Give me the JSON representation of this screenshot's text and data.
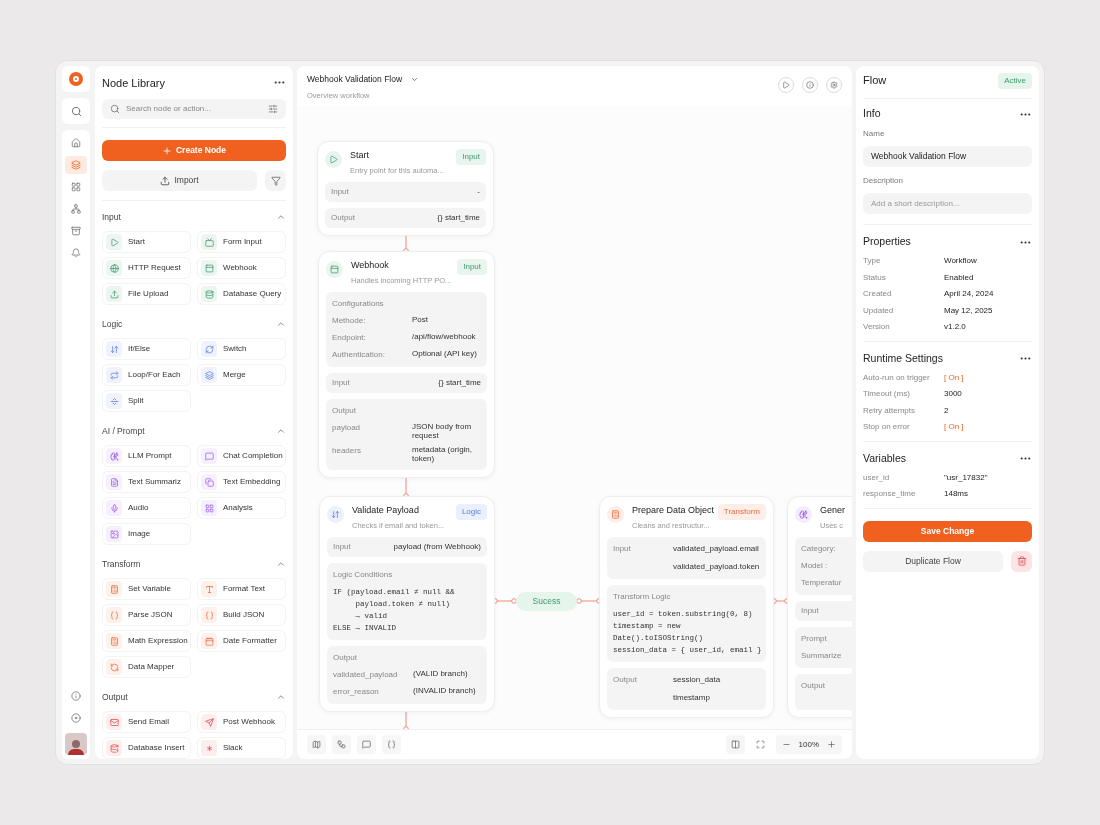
{
  "nav": [
    {
      "selected": false
    },
    {
      "selected": true
    },
    {
      "selected": false
    },
    {
      "selected": false
    },
    {
      "selected": false
    },
    {
      "selected": false
    }
  ],
  "library": {
    "title": "Node Library",
    "search_placeholder": "Search node or action...",
    "create_label": "Create Node",
    "import_label": "Import",
    "sections": [
      {
        "title": "Input",
        "expanded": true,
        "kind": "input",
        "items": [
          "Start",
          "Form Input",
          "HTTP Request",
          "Webhook",
          "File Upload",
          "Database Query"
        ]
      },
      {
        "title": "Logic",
        "expanded": true,
        "kind": "logic",
        "items": [
          "If/Else",
          "Switch",
          "Loop/For Each",
          "Merge",
          "Split"
        ]
      },
      {
        "title": "AI / Prompt",
        "expanded": true,
        "kind": "ai",
        "items": [
          "LLM Prompt",
          "Chat Completion",
          "Text Summariz",
          "Text Embedding",
          "Audio",
          "Analysis",
          "Image"
        ]
      },
      {
        "title": "Transform",
        "expanded": true,
        "kind": "transform",
        "items": [
          "Set Variable",
          "Format Text",
          "Parse JSON",
          "Build JSON",
          "Math Expression",
          "Date Formatter",
          "Data Mapper"
        ]
      },
      {
        "title": "Output",
        "expanded": true,
        "kind": "output",
        "items": [
          "Send Email",
          "Post Webhook",
          "Database Insert",
          "Slack"
        ]
      }
    ]
  },
  "canvas": {
    "title": "Webhook Validation Flow",
    "subtitle": "Overview workflow",
    "zoom": "100%",
    "branch_label": "Sucess",
    "nodes": [
      {
        "kind": "input",
        "title": "Start",
        "subtitle": "Entry point for this automa...",
        "badge": "Input",
        "blocks": [
          {
            "kind": "row",
            "label": "Input",
            "value": "-"
          },
          {
            "kind": "row",
            "label": "Output",
            "value": "{} start_time"
          }
        ]
      },
      {
        "kind": "input",
        "title": "Webhook",
        "subtitle": "Handles incoming HTTP PO...",
        "badge": "Input",
        "blocks": [
          {
            "kind": "table",
            "heading": "Configurations",
            "rows": [
              {
                "label": "Methode:",
                "value": "Post"
              },
              {
                "label": "Endpoint:",
                "value": "/api/flow/webhook"
              },
              {
                "label": "Authentication:",
                "value": "Optional (API key)"
              }
            ]
          },
          {
            "kind": "row",
            "label": "Input",
            "value": "{} start_time"
          },
          {
            "kind": "table",
            "heading": "Output",
            "rows": [
              {
                "label": "payload",
                "value": "JSON body from request"
              },
              {
                "label": "headers",
                "value": "metadata (origin, token)"
              }
            ]
          }
        ]
      },
      {
        "kind": "logic",
        "title": "Validate Payload",
        "subtitle": "Checks if email and token...",
        "badge": "Logic",
        "blocks": [
          {
            "kind": "row",
            "label": "Input",
            "value": "payload (from Webhook)"
          },
          {
            "kind": "code",
            "heading": "Logic Conditions",
            "lines": [
              "IF (payload.email ≠ null &&",
              "     payload.token ≠ null)",
              "     → valid",
              "ELSE → INVALID"
            ]
          },
          {
            "kind": "table",
            "heading": "Output",
            "rows": [
              {
                "label": "validated_payload",
                "value": "(VALID branch)"
              },
              {
                "label": "error_reason",
                "value": "(INVALID branch)"
              }
            ]
          }
        ]
      },
      {
        "kind": "transform",
        "title": "Prepare Data Object",
        "subtitle": "Cleans and restructur...",
        "badge": "Transform",
        "blocks": [
          {
            "kind": "list",
            "label": "Input",
            "values": [
              "validated_payload.email",
              "validated_payload.token"
            ]
          },
          {
            "kind": "code",
            "heading": "Transform Logic",
            "lines": [
              "user_id = token.substring(0, 8)",
              "timestamp = new",
              "Date().toISOString()",
              "session_data = { user_id, email }"
            ]
          },
          {
            "kind": "list",
            "label": "Output",
            "values": [
              "session_data",
              "timestamp"
            ]
          }
        ]
      },
      {
        "kind": "ai",
        "title": "Gener",
        "subtitle": "Uses c",
        "blocks": [
          {
            "kind": "table",
            "rows": [
              {
                "label": "Category:"
              },
              {
                "label": "Model :"
              },
              {
                "label": "Temperatur"
              }
            ]
          },
          {
            "kind": "row",
            "label": "Input"
          },
          {
            "kind": "table",
            "rows": [
              {
                "label": "Prompt"
              },
              {
                "label": "Summarize"
              }
            ]
          },
          {
            "kind": "list",
            "label": "Output"
          }
        ]
      }
    ]
  },
  "panel": {
    "title": "Flow",
    "status": "Active",
    "info": {
      "title": "Info",
      "name_label": "Name",
      "name_value": "Webhook Validation Flow",
      "description_label": "Description",
      "description_placeholder": "Add a short description..."
    },
    "sections": [
      {
        "title": "Properties",
        "rows": [
          {
            "label": "Type",
            "value": "Workflow",
            "kind": "text"
          },
          {
            "label": "Status",
            "value": "Enabled",
            "kind": "text"
          },
          {
            "label": "Created",
            "value": "April 24, 2024",
            "kind": "text"
          },
          {
            "label": "Updated",
            "value": "May 12, 2025",
            "kind": "text"
          },
          {
            "label": "Version",
            "value": "v1.2.0",
            "kind": "text"
          }
        ]
      },
      {
        "title": "Runtime Settings",
        "rows": [
          {
            "label": "Auto-run on trigger",
            "value": "[ On ]",
            "kind": "toggle"
          },
          {
            "label": "Timeout (ms)",
            "value": "3000",
            "kind": "text"
          },
          {
            "label": "Retry attempts",
            "value": "2",
            "kind": "text"
          },
          {
            "label": "Stop on error",
            "value": "[ On ]",
            "kind": "toggle"
          }
        ]
      },
      {
        "title": "Variables",
        "rows": [
          {
            "label": "user_id",
            "value": "\"usr_17832\"",
            "kind": "text"
          },
          {
            "label": "response_time",
            "value": "148ms",
            "kind": "text"
          }
        ]
      }
    ],
    "save_label": "Save Change",
    "duplicate_label": "Duplicate Flow"
  }
}
